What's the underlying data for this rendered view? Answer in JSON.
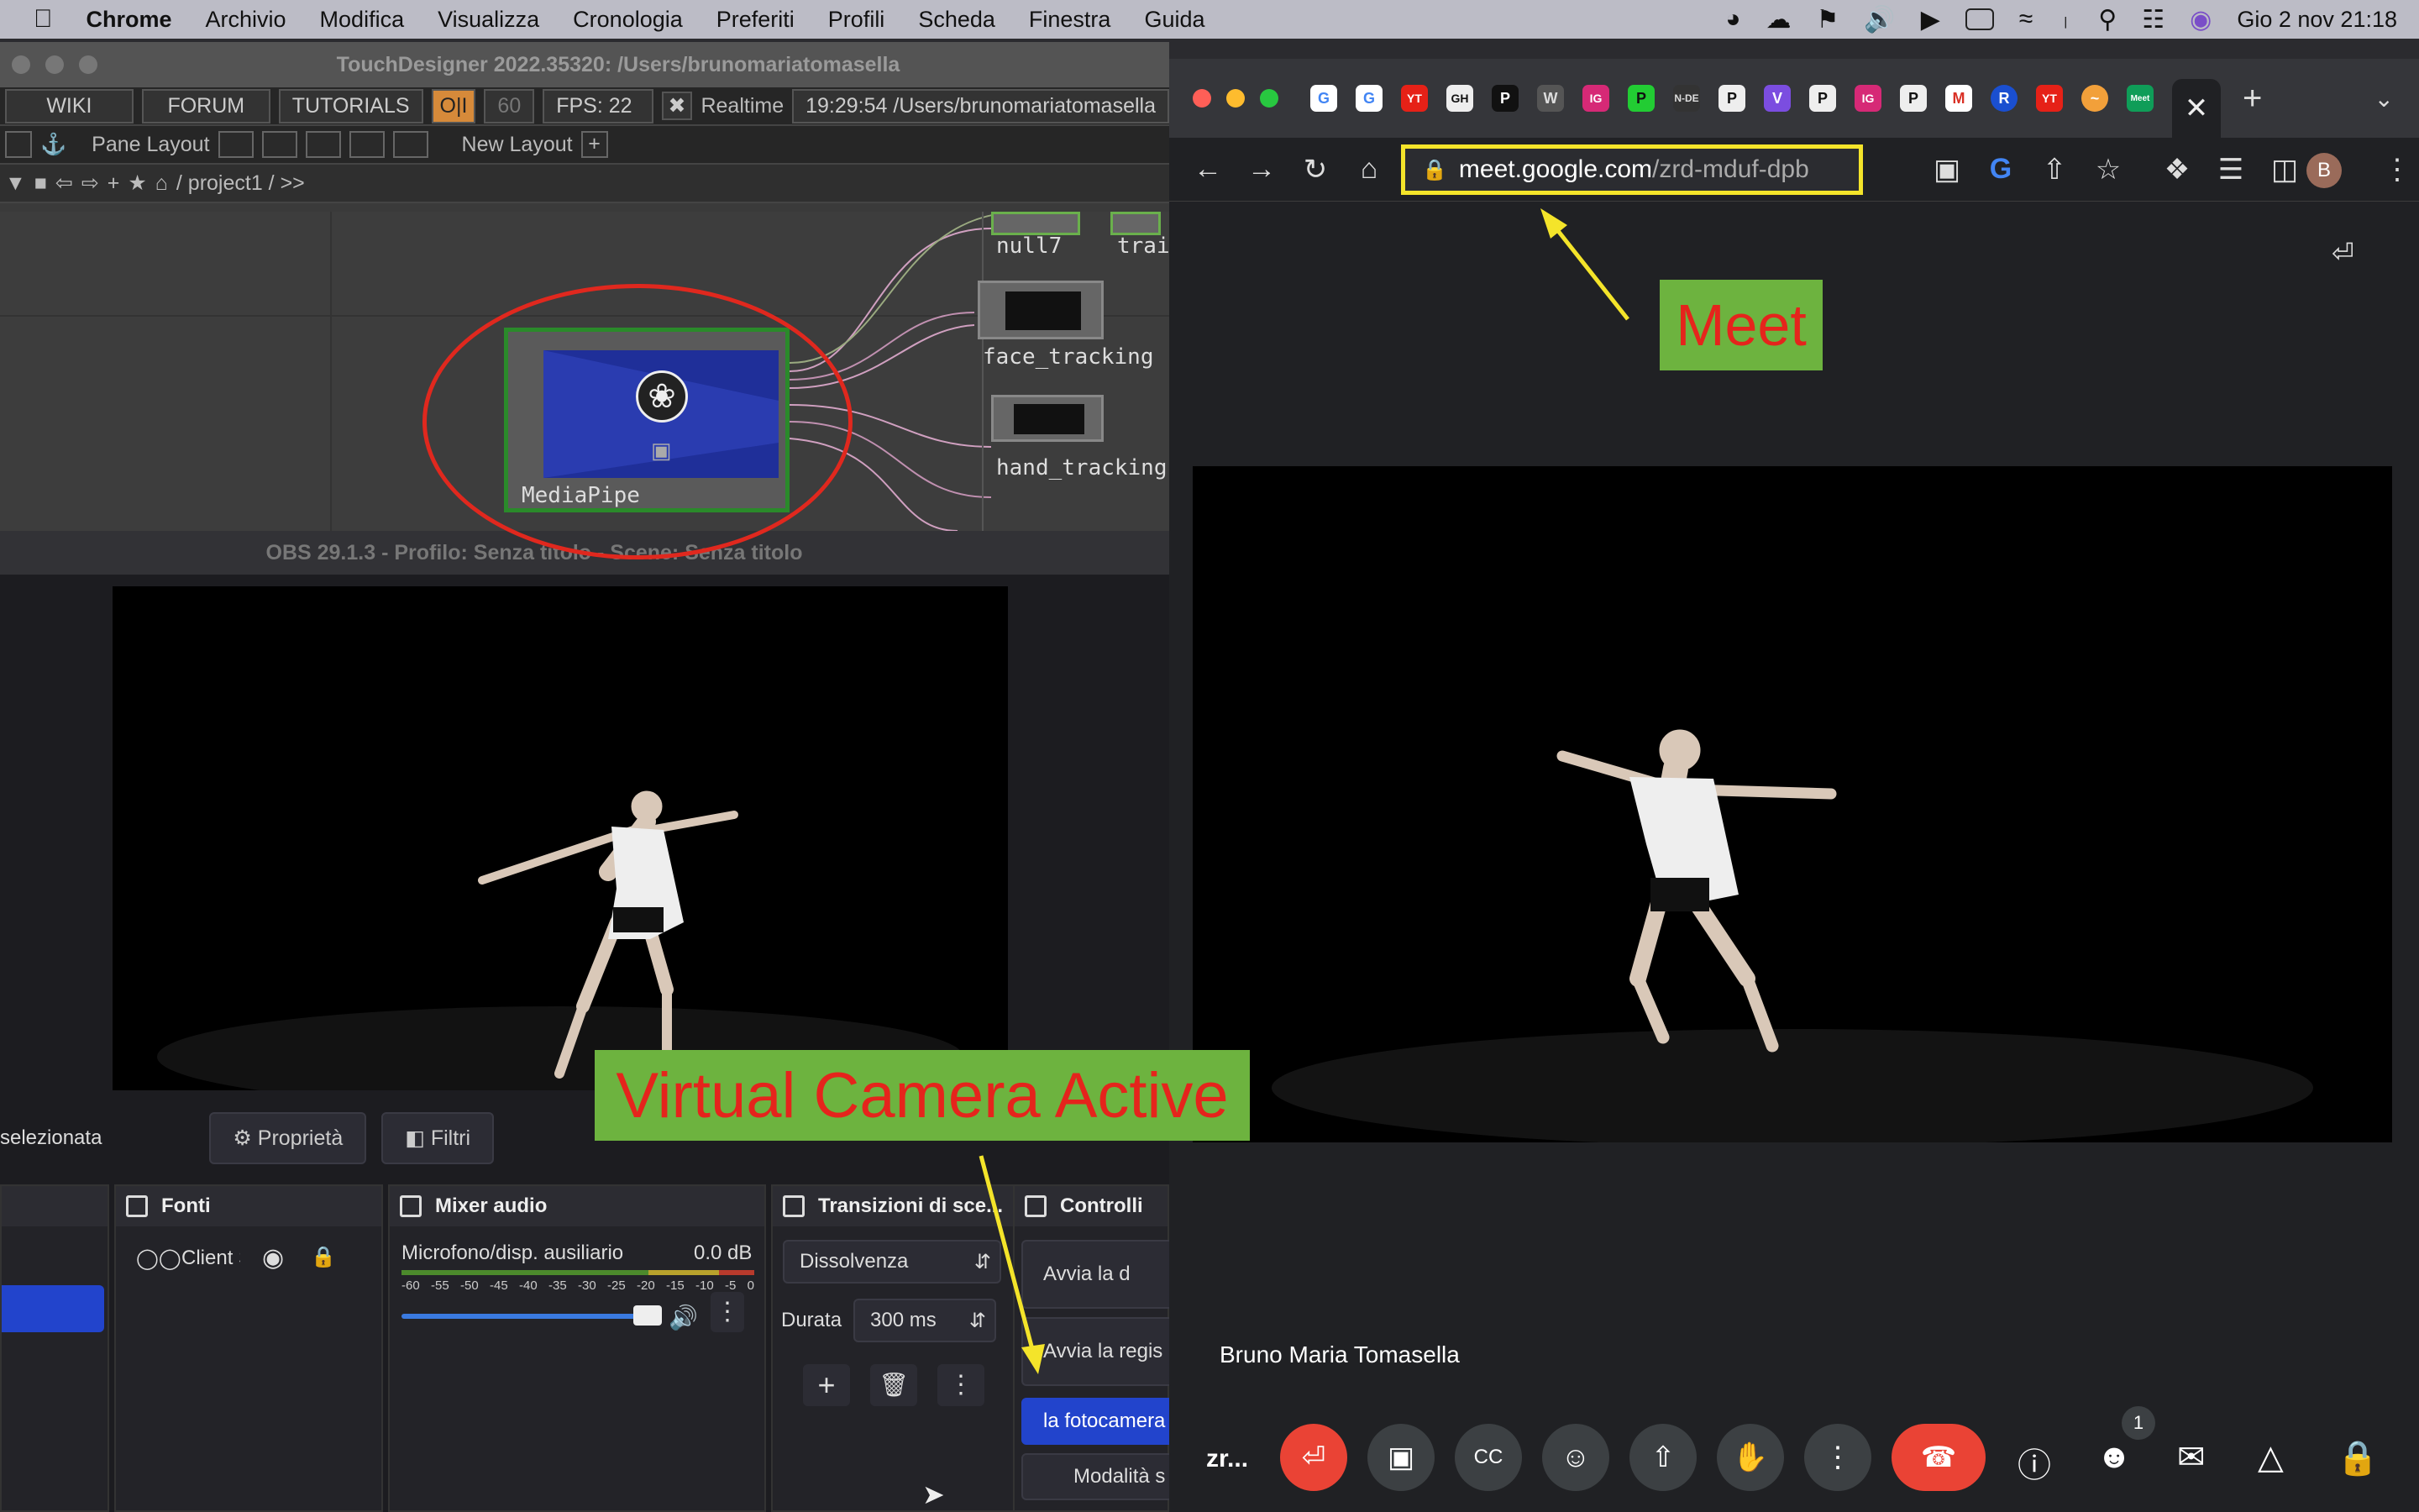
{
  "menubar": {
    "app_name": "Chrome",
    "items": [
      "Archivio",
      "Modifica",
      "Visualizza",
      "Cronologia",
      "Preferiti",
      "Profili",
      "Scheda",
      "Finestra",
      "Guida"
    ],
    "clock": "Gio 2 nov  21:18"
  },
  "touchdesigner": {
    "title": "TouchDesigner 2022.35320: /Users/brunomariatomasella",
    "toolbar": {
      "wiki": "WIKI",
      "forum": "FORUM",
      "tutorials": "TUTORIALS",
      "oi": "O|I",
      "fps_target": "60",
      "fps": "FPS:  22",
      "realtime": "Realtime",
      "time_path": "19:29:54  /Users/brunomariatomasella"
    },
    "layout": {
      "pane_layout": "Pane Layout",
      "new_layout": "New Layout"
    },
    "path": "/ project1 / >>",
    "nodes": {
      "mediapipe": "MediaPipe",
      "null7": "null7",
      "trail": "trail",
      "face_tracking": "face_tracking",
      "hand_tracking": "hand_tracking"
    }
  },
  "obs": {
    "title": "OBS 29.1.3 - Profilo: Senza titolo - Scene: Senza titolo",
    "no_source": "selezionata",
    "properties": "Proprietà",
    "filters": "Filtri",
    "docks": {
      "sources": {
        "title": "Fonti",
        "item": "Client S"
      },
      "mixer": {
        "title": "Mixer audio",
        "device": "Microfono/disp. ausiliario",
        "level": "0.0 dB",
        "scale": [
          "-60",
          "-55",
          "-50",
          "-45",
          "-40",
          "-35",
          "-30",
          "-25",
          "-20",
          "-15",
          "-10",
          "-5",
          "0"
        ]
      },
      "transitions": {
        "title": "Transizioni di sce...",
        "type": "Dissolvenza",
        "duration_label": "Durata",
        "duration": "300 ms"
      },
      "controls": {
        "title": "Controlli",
        "stream": "Avvia la d",
        "record": "Avvia la regis",
        "virtual_cam": "la fotocamera",
        "studio": "Modalità s"
      }
    }
  },
  "chrome": {
    "url_host": "meet.google.com",
    "url_path": "/zrd-mduf-dpb",
    "tabs": [
      "G",
      "G",
      "YT",
      "GH",
      "P",
      "W",
      "IG",
      "P",
      "N-DE",
      "P",
      "V",
      "P",
      "IG",
      "P",
      "M",
      "R",
      "YT",
      "~",
      "Meet"
    ],
    "profile_initial": "B"
  },
  "meet": {
    "participant": "Bruno Maria Tomasella",
    "meeting_code": "zr...",
    "people_count": "1"
  },
  "annotations": {
    "meet": "Meet",
    "virtual_camera": "Virtual Camera Active"
  },
  "colors": {
    "annotation_bg": "#6db33f",
    "annotation_text": "#e5241c",
    "highlight": "#f4e42a",
    "circle": "#e0281e",
    "end_call": "#ea4335",
    "obs_active": "#2244cc"
  }
}
